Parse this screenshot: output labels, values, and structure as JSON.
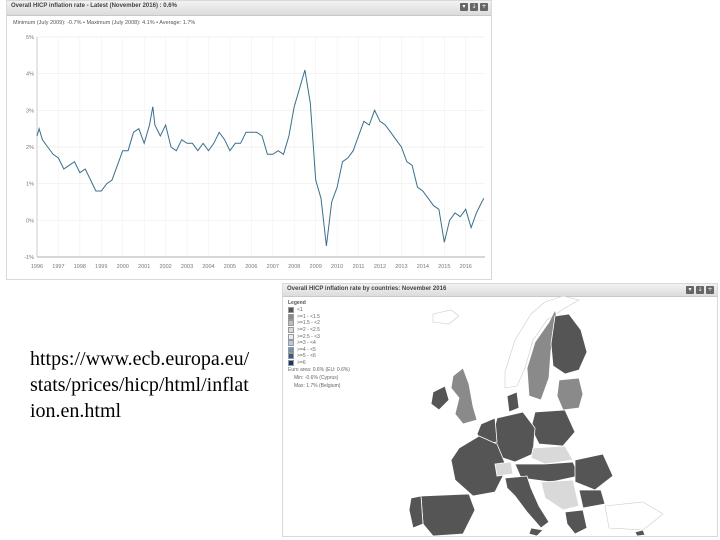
{
  "chart": {
    "title": "Overall HICP inflation rate - Latest (November 2016) : 0.6%",
    "stats": "Minimum (July 2009): -0.7% • Maximum (July 2008): 4.1% • Average: 1.7%",
    "icons": [
      "funnel-icon",
      "download-icon",
      "expand-icon"
    ]
  },
  "chart_data": {
    "type": "line",
    "title": "Overall HICP inflation rate - Latest (November 2016) : 0.6%",
    "xlabel": "",
    "ylabel": "",
    "y_tick_labels": [
      "5%",
      "4%",
      "3%",
      "2%",
      "1%",
      "0%",
      "-1%"
    ],
    "x_tick_labels": [
      "1996",
      "1997",
      "1998",
      "1999",
      "2000",
      "2001",
      "2002",
      "2003",
      "2004",
      "2005",
      "2006",
      "2007",
      "2008",
      "2009",
      "2010",
      "2011",
      "2012",
      "2013",
      "2014",
      "2015",
      "2016"
    ],
    "ylim": [
      -1,
      5
    ],
    "xlim": [
      1996,
      2016.9
    ],
    "grid": true,
    "series": [
      {
        "color": "#3a6f8c",
        "x": [
          1996.0,
          1996.1,
          1996.25,
          1996.5,
          1996.75,
          1997.0,
          1997.25,
          1997.5,
          1997.75,
          1998.0,
          1998.25,
          1998.5,
          1998.75,
          1999.0,
          1999.25,
          1999.5,
          1999.75,
          2000.0,
          2000.25,
          2000.5,
          2000.75,
          2001.0,
          2001.25,
          2001.4,
          2001.5,
          2001.75,
          2002.0,
          2002.25,
          2002.5,
          2002.75,
          2003.0,
          2003.25,
          2003.5,
          2003.75,
          2004.0,
          2004.25,
          2004.5,
          2004.75,
          2005.0,
          2005.25,
          2005.5,
          2005.75,
          2006.0,
          2006.25,
          2006.5,
          2006.75,
          2007.0,
          2007.25,
          2007.5,
          2007.75,
          2008.0,
          2008.25,
          2008.5,
          2008.75,
          2009.0,
          2009.25,
          2009.5,
          2009.75,
          2010.0,
          2010.25,
          2010.5,
          2010.75,
          2011.0,
          2011.25,
          2011.5,
          2011.75,
          2012.0,
          2012.25,
          2012.5,
          2012.75,
          2013.0,
          2013.25,
          2013.5,
          2013.75,
          2014.0,
          2014.25,
          2014.5,
          2014.75,
          2015.0,
          2015.25,
          2015.5,
          2015.75,
          2016.0,
          2016.25,
          2016.5,
          2016.75,
          2016.85
        ],
        "y": [
          2.3,
          2.5,
          2.2,
          2.0,
          1.8,
          1.7,
          1.4,
          1.5,
          1.6,
          1.3,
          1.4,
          1.1,
          0.8,
          0.8,
          1.0,
          1.1,
          1.5,
          1.9,
          1.9,
          2.4,
          2.5,
          2.1,
          2.6,
          3.1,
          2.6,
          2.3,
          2.6,
          2.0,
          1.9,
          2.2,
          2.1,
          2.1,
          1.9,
          2.1,
          1.9,
          2.1,
          2.4,
          2.2,
          1.9,
          2.1,
          2.1,
          2.4,
          2.4,
          2.4,
          2.3,
          1.8,
          1.8,
          1.9,
          1.8,
          2.3,
          3.1,
          3.6,
          4.1,
          3.2,
          1.1,
          0.6,
          -0.7,
          0.5,
          0.9,
          1.6,
          1.7,
          1.9,
          2.3,
          2.7,
          2.6,
          3.0,
          2.7,
          2.6,
          2.4,
          2.2,
          2.0,
          1.6,
          1.5,
          0.9,
          0.8,
          0.6,
          0.4,
          0.3,
          -0.6,
          0.0,
          0.2,
          0.1,
          0.3,
          -0.2,
          0.2,
          0.5,
          0.6
        ]
      }
    ]
  },
  "map": {
    "title": "Overall HICP inflation rate by countries: November 2016",
    "icons": [
      "funnel-icon",
      "download-icon",
      "expand-icon"
    ],
    "legend_title": "Legend",
    "legend_items": [
      {
        "label": "<1",
        "color": "#555555"
      },
      {
        "label": ">=1 - <1.5",
        "color": "#8a8a8a"
      },
      {
        "label": ">=1.5 - <2",
        "color": "#bdbdbd"
      },
      {
        "label": ">=2 - <2.5",
        "color": "#d9d9d9"
      },
      {
        "label": ">=2.5 - <3",
        "color": "#e8edf3"
      },
      {
        "label": ">=3 - <4",
        "color": "#b3c8dd"
      },
      {
        "label": ">=4 - <5",
        "color": "#6f93b8"
      },
      {
        "label": ">=5 - <6",
        "color": "#305f8e"
      },
      {
        "label": ">=6",
        "color": "#123a66"
      }
    ],
    "euro_area": "Euro area: 0.6% (EU: 0.6%)",
    "min": "Min: -0.6% (Cyprus)",
    "max": "Max: 1.7% (Belgium)"
  },
  "caption": {
    "url": "https://www.ecb.europa.eu/stats/prices/hicp/html/inflation.en.html"
  }
}
